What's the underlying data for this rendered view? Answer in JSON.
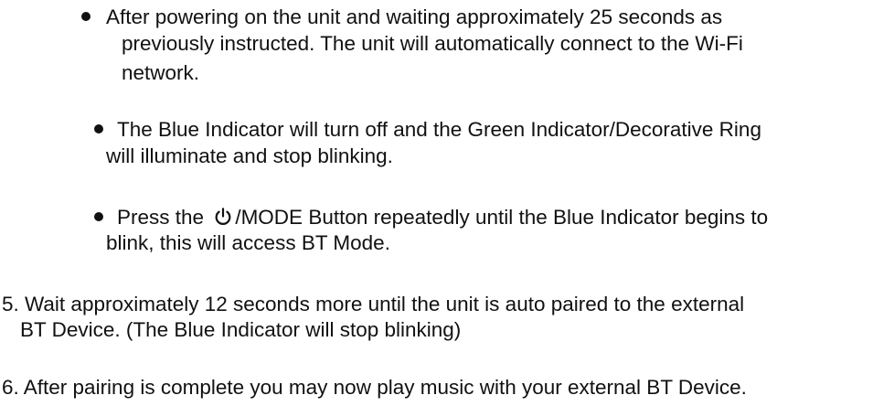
{
  "bullets": [
    {
      "lines": [
        "After powering on the unit and waiting approximately 25 seconds as",
        "previously instructed. The unit will automatically connect to the Wi-Fi",
        "network."
      ]
    },
    {
      "lines": [
        "The Blue Indicator will turn off and the Green Indicator/Decorative Ring",
        "will illuminate and stop blinking."
      ]
    },
    {
      "line1_before_icon": "Press the",
      "line1_after_icon": "/MODE Button repeatedly until the Blue Indicator begins to",
      "line2": "blink, this will access BT Mode.",
      "icon": "power-icon"
    }
  ],
  "steps": [
    {
      "lines": [
        "5. Wait approximately 12 seconds more until the unit is auto paired to the external",
        "BT Device. (The Blue Indicator will stop blinking)"
      ]
    },
    {
      "lines": [
        "6. After pairing is complete you may now play music with your external BT Device."
      ]
    }
  ]
}
